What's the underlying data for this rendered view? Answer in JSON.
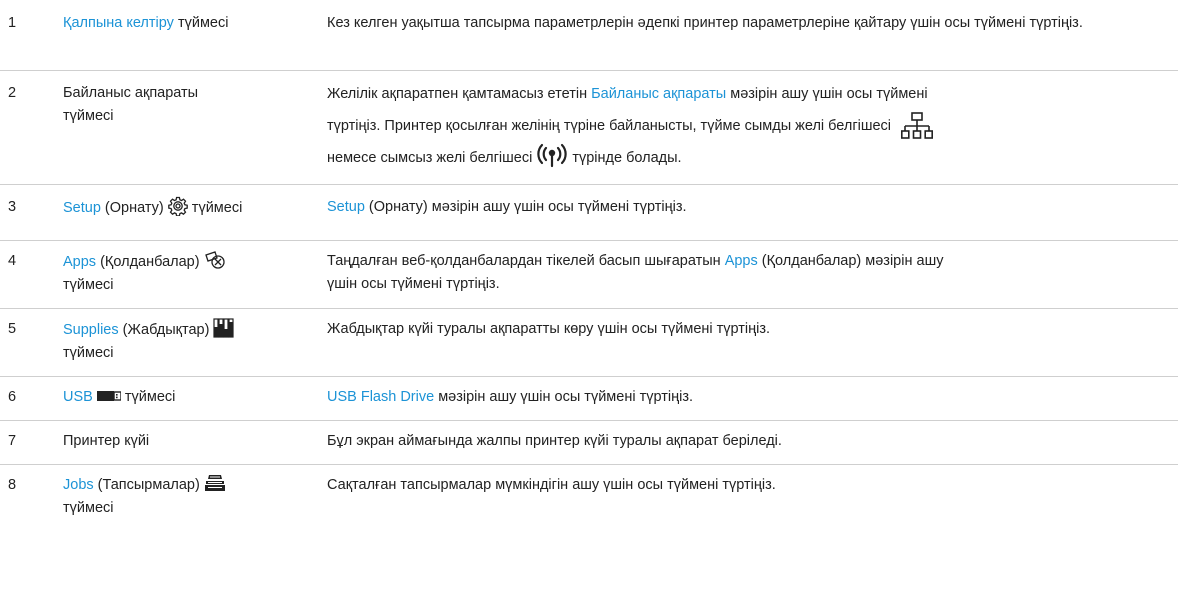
{
  "rows": [
    {
      "num": "1",
      "name": {
        "link": "Қалпына келтіру",
        "text": " түймесі"
      },
      "desc": "Кез келген уақытша тапсырма параметрлерін әдепкі принтер параметрлеріне қайтару үшін осы түймені түртіңіз."
    },
    {
      "num": "2",
      "name": {
        "text": "Байланыс ақпараты түймесі"
      },
      "desc": {
        "pre": "Желілік ақпаратпен қамтамасыз ететін ",
        "link": "Байланыс ақпараты",
        "post": " мәзірін ашу үшін осы түймені",
        "line2": "түртіңіз. Принтер қосылған желінің түріне байланысты, түйме сымды желі белгішесі",
        "line3_pre": "немесе сымсыз желі белгішесі ",
        "line3_post": " түрінде болады."
      }
    },
    {
      "num": "3",
      "name": {
        "link": "Setup",
        "text": " (Орнату) ",
        "text2": " түймесі"
      },
      "desc": {
        "link": "Setup",
        "post": " (Орнату) мәзірін ашу үшін осы түймені түртіңіз."
      }
    },
    {
      "num": "4",
      "name": {
        "link": "Apps",
        "text": " (Қолданбалар) ",
        "text2": "түймесі"
      },
      "desc": {
        "pre": "Таңдалған веб-қолданбалардан тікелей басып шығаратын ",
        "link": "Apps",
        "post": " (Қолданбалар) мәзірін ашу",
        "line2": "үшін осы түймені түртіңіз."
      }
    },
    {
      "num": "5",
      "name": {
        "link": "Supplies",
        "text": " (Жабдықтар) ",
        "text2": "түймесі"
      },
      "desc": "Жабдықтар күйі туралы ақпаратты көру үшін осы түймені түртіңіз."
    },
    {
      "num": "6",
      "name": {
        "link": "USB",
        "text": " түймесі"
      },
      "desc": {
        "link": "USB Flash Drive",
        "post": " мәзірін ашу үшін осы түймені түртіңіз."
      }
    },
    {
      "num": "7",
      "name": {
        "text": "Принтер күйі"
      },
      "desc": "Бұл экран аймағында жалпы принтер күйі туралы ақпарат беріледі."
    },
    {
      "num": "8",
      "name": {
        "link": "Jobs",
        "text": " (Тапсырмалар) ",
        "text2": "түймесі"
      },
      "desc": "Сақталған тапсырмалар мүмкіндігін ашу үшін осы түймені түртіңіз."
    }
  ],
  "icons": {
    "wired": "wired-network-icon",
    "wireless": "wireless-network-icon",
    "setup": "gear-icon",
    "apps": "apps-icon",
    "supplies": "supplies-icon",
    "usb": "usb-drive-icon",
    "jobs": "jobs-tray-icon"
  },
  "colors": {
    "link": "#1c93d6",
    "text": "#222222",
    "separator": "#cfcfcf"
  }
}
